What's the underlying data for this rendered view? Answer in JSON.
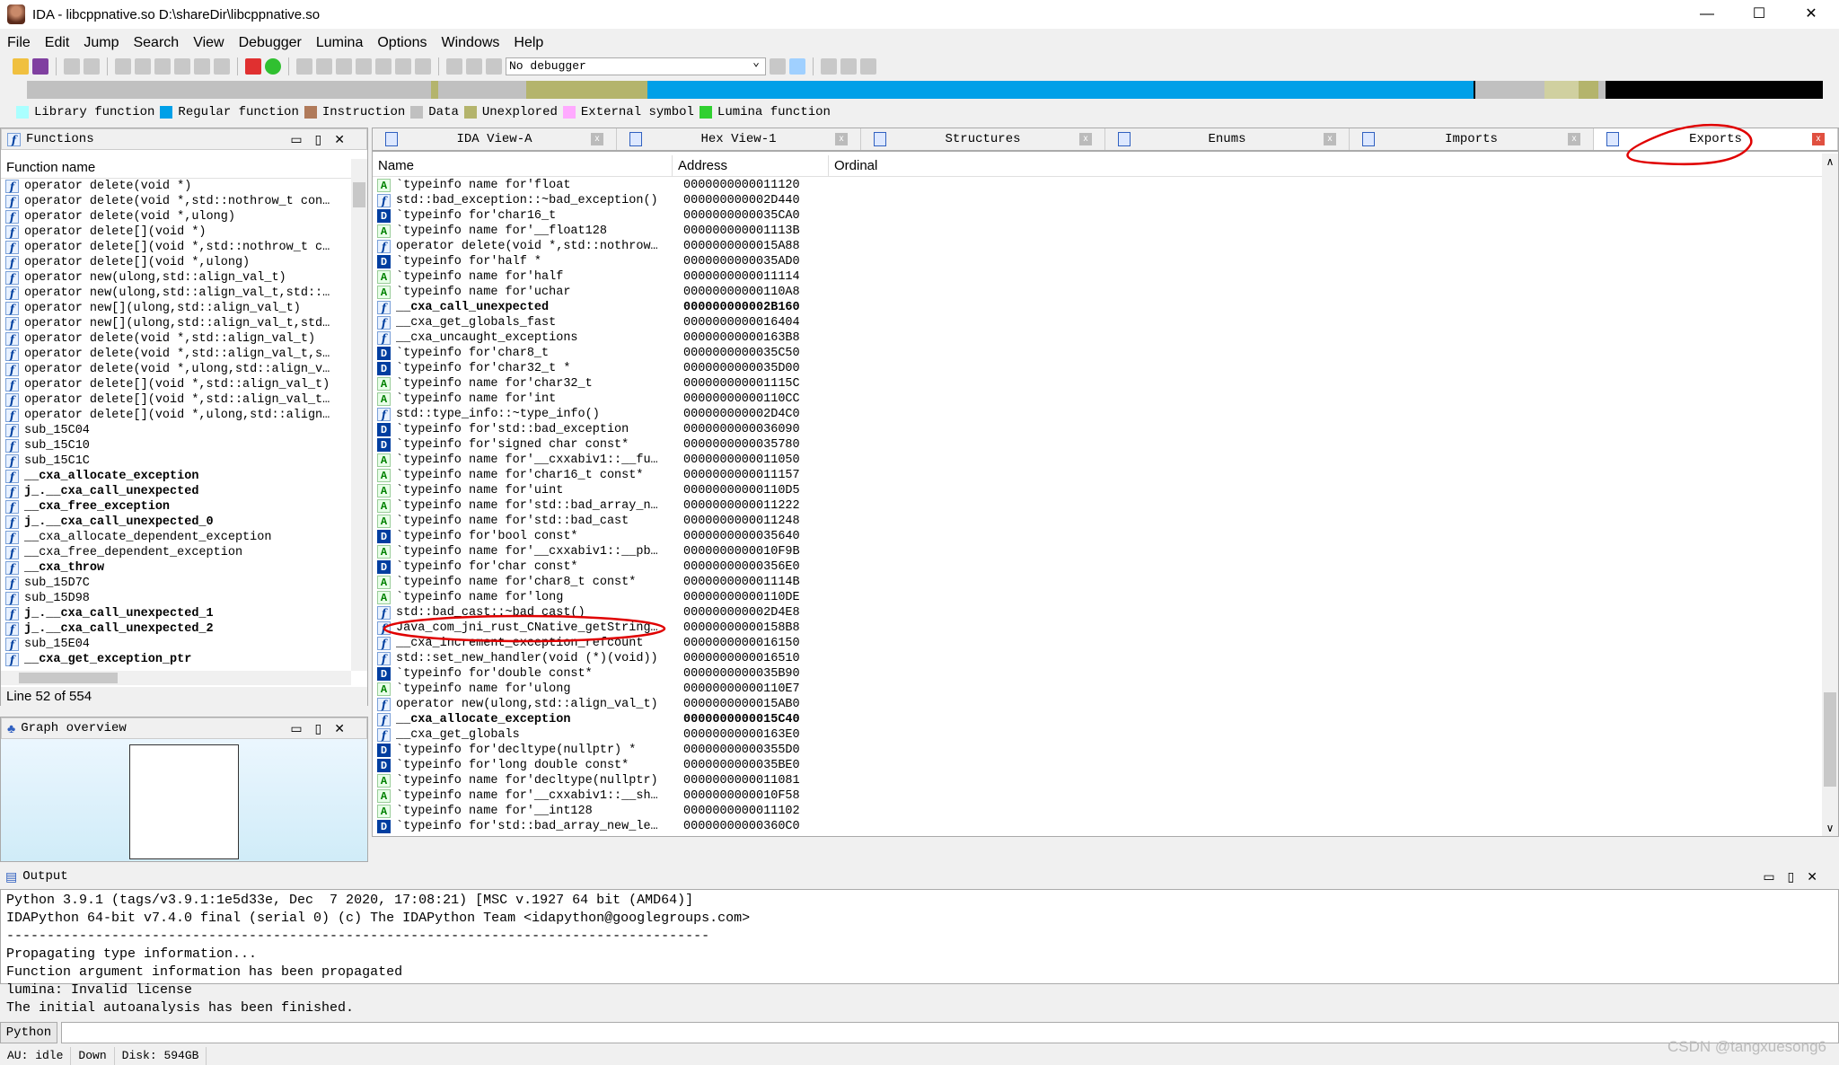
{
  "window": {
    "title": "IDA - libcppnative.so D:\\shareDir\\libcppnative.so",
    "minimize": "—",
    "maximize": "☐",
    "close": "✕"
  },
  "menu": [
    "File",
    "Edit",
    "Jump",
    "Search",
    "View",
    "Debugger",
    "Lumina",
    "Options",
    "Windows",
    "Help"
  ],
  "toolbar": {
    "debugger_select": "No debugger"
  },
  "legend": [
    {
      "label": "Library function",
      "color": "#aaffff"
    },
    {
      "label": "Regular function",
      "color": "#00a0e8"
    },
    {
      "label": "Instruction",
      "color": "#b07a5a"
    },
    {
      "label": "Data",
      "color": "#c0c0c0"
    },
    {
      "label": "Unexplored",
      "color": "#b4b46c"
    },
    {
      "label": "External symbol",
      "color": "#ffaaff"
    },
    {
      "label": "Lumina function",
      "color": "#30d030"
    }
  ],
  "functions": {
    "title": "Functions",
    "column": "Function name",
    "status": "Line 52 of 554",
    "items": [
      {
        "n": "operator delete(void *)"
      },
      {
        "n": "operator delete(void *,std::nothrow_t con…"
      },
      {
        "n": "operator delete(void *,ulong)"
      },
      {
        "n": "operator delete[](void *)"
      },
      {
        "n": "operator delete[](void *,std::nothrow_t c…"
      },
      {
        "n": "operator delete[](void *,ulong)"
      },
      {
        "n": "operator new(ulong,std::align_val_t)"
      },
      {
        "n": "operator new(ulong,std::align_val_t,std::…"
      },
      {
        "n": "operator new[](ulong,std::align_val_t)"
      },
      {
        "n": "operator new[](ulong,std::align_val_t,std…"
      },
      {
        "n": "operator delete(void *,std::align_val_t)"
      },
      {
        "n": "operator delete(void *,std::align_val_t,s…"
      },
      {
        "n": "operator delete(void *,ulong,std::align_v…"
      },
      {
        "n": "operator delete[](void *,std::align_val_t)"
      },
      {
        "n": "operator delete[](void *,std::align_val_t…"
      },
      {
        "n": "operator delete[](void *,ulong,std::align…"
      },
      {
        "n": "sub_15C04"
      },
      {
        "n": "sub_15C10"
      },
      {
        "n": "sub_15C1C"
      },
      {
        "n": "__cxa_allocate_exception",
        "b": true
      },
      {
        "n": "j_.__cxa_call_unexpected",
        "b": true
      },
      {
        "n": "__cxa_free_exception",
        "b": true
      },
      {
        "n": "j_.__cxa_call_unexpected_0",
        "b": true
      },
      {
        "n": "__cxa_allocate_dependent_exception"
      },
      {
        "n": "__cxa_free_dependent_exception"
      },
      {
        "n": "__cxa_throw",
        "b": true
      },
      {
        "n": "sub_15D7C"
      },
      {
        "n": "sub_15D98"
      },
      {
        "n": "j_.__cxa_call_unexpected_1",
        "b": true
      },
      {
        "n": "j_.__cxa_call_unexpected_2",
        "b": true
      },
      {
        "n": "sub_15E04"
      },
      {
        "n": "__cxa_get_exception_ptr",
        "b": true
      }
    ]
  },
  "graph_overview": {
    "title": "Graph overview"
  },
  "tabs": [
    {
      "label": "IDA View-A"
    },
    {
      "label": "Hex View-1"
    },
    {
      "label": "Structures"
    },
    {
      "label": "Enums"
    },
    {
      "label": "Imports"
    },
    {
      "label": "Exports",
      "active": true
    }
  ],
  "exports": {
    "columns": [
      "Name",
      "Address",
      "Ordinal"
    ],
    "rows": [
      {
        "t": "A",
        "n": "`typeinfo name for'float",
        "a": "0000000000011120"
      },
      {
        "t": "f",
        "n": "std::bad_exception::~bad_exception()",
        "a": "000000000002D440"
      },
      {
        "t": "D",
        "n": "`typeinfo for'char16_t",
        "a": "0000000000035CA0"
      },
      {
        "t": "A",
        "n": "`typeinfo name for'__float128",
        "a": "000000000001113B"
      },
      {
        "t": "f",
        "n": "operator delete(void *,std::nothrow…",
        "a": "0000000000015A88"
      },
      {
        "t": "D",
        "n": "`typeinfo for'half *",
        "a": "0000000000035AD0"
      },
      {
        "t": "A",
        "n": "`typeinfo name for'half",
        "a": "0000000000011114"
      },
      {
        "t": "A",
        "n": "`typeinfo name for'uchar",
        "a": "00000000000110A8"
      },
      {
        "t": "f",
        "n": "__cxa_call_unexpected",
        "a": "000000000002B160",
        "b": true
      },
      {
        "t": "f",
        "n": "__cxa_get_globals_fast",
        "a": "0000000000016404"
      },
      {
        "t": "f",
        "n": "__cxa_uncaught_exceptions",
        "a": "00000000000163B8"
      },
      {
        "t": "D",
        "n": "`typeinfo for'char8_t",
        "a": "0000000000035C50"
      },
      {
        "t": "D",
        "n": "`typeinfo for'char32_t *",
        "a": "0000000000035D00"
      },
      {
        "t": "A",
        "n": "`typeinfo name for'char32_t",
        "a": "000000000001115C"
      },
      {
        "t": "A",
        "n": "`typeinfo name for'int",
        "a": "00000000000110CC"
      },
      {
        "t": "f",
        "n": "std::type_info::~type_info()",
        "a": "000000000002D4C0"
      },
      {
        "t": "D",
        "n": "`typeinfo for'std::bad_exception",
        "a": "0000000000036090"
      },
      {
        "t": "D",
        "n": "`typeinfo for'signed char const*",
        "a": "0000000000035780"
      },
      {
        "t": "A",
        "n": "`typeinfo name for'__cxxabiv1::__fu…",
        "a": "0000000000011050"
      },
      {
        "t": "A",
        "n": "`typeinfo name for'char16_t const*",
        "a": "0000000000011157"
      },
      {
        "t": "A",
        "n": "`typeinfo name for'uint",
        "a": "00000000000110D5"
      },
      {
        "t": "A",
        "n": "`typeinfo name for'std::bad_array_n…",
        "a": "0000000000011222"
      },
      {
        "t": "A",
        "n": "`typeinfo name for'std::bad_cast",
        "a": "0000000000011248"
      },
      {
        "t": "D",
        "n": "`typeinfo for'bool const*",
        "a": "0000000000035640"
      },
      {
        "t": "A",
        "n": "`typeinfo name for'__cxxabiv1::__pb…",
        "a": "0000000000010F9B"
      },
      {
        "t": "D",
        "n": "`typeinfo for'char const*",
        "a": "00000000000356E0"
      },
      {
        "t": "A",
        "n": "`typeinfo name for'char8_t const*",
        "a": "000000000001114B"
      },
      {
        "t": "A",
        "n": "`typeinfo name for'long",
        "a": "00000000000110DE"
      },
      {
        "t": "f",
        "n": "std::bad_cast::~bad_cast()",
        "a": "000000000002D4E8"
      },
      {
        "t": "f",
        "n": "Java_com_jni_rust_CNative_getString…",
        "a": "00000000000158B8"
      },
      {
        "t": "f",
        "n": "__cxa_increment_exception_refcount",
        "a": "0000000000016150"
      },
      {
        "t": "f",
        "n": "std::set_new_handler(void (*)(void))",
        "a": "0000000000016510"
      },
      {
        "t": "D",
        "n": "`typeinfo for'double const*",
        "a": "0000000000035B90"
      },
      {
        "t": "A",
        "n": "`typeinfo name for'ulong",
        "a": "00000000000110E7"
      },
      {
        "t": "f",
        "n": "operator new(ulong,std::align_val_t)",
        "a": "0000000000015AB0"
      },
      {
        "t": "f",
        "n": "__cxa_allocate_exception",
        "a": "0000000000015C40",
        "b": true
      },
      {
        "t": "f",
        "n": "__cxa_get_globals",
        "a": "00000000000163E0"
      },
      {
        "t": "D",
        "n": "`typeinfo for'decltype(nullptr) *",
        "a": "00000000000355D0"
      },
      {
        "t": "D",
        "n": "`typeinfo for'long double const*",
        "a": "0000000000035BE0"
      },
      {
        "t": "A",
        "n": "`typeinfo name for'decltype(nullptr)",
        "a": "0000000000011081"
      },
      {
        "t": "A",
        "n": "`typeinfo name for'__cxxabiv1::__sh…",
        "a": "0000000000010F58"
      },
      {
        "t": "A",
        "n": "`typeinfo name for'__int128",
        "a": "0000000000011102"
      },
      {
        "t": "D",
        "n": "`typeinfo for'std::bad_array_new_le…",
        "a": "00000000000360C0"
      }
    ]
  },
  "output": {
    "title": "Output",
    "lines": [
      "Python 3.9.1 (tags/v3.9.1:1e5d33e, Dec  7 2020, 17:08:21) [MSC v.1927 64 bit (AMD64)]",
      "IDAPython 64-bit v7.4.0 final (serial 0) (c) The IDAPython Team <idapython@googlegroups.com>",
      "---------------------------------------------------------------------------------------",
      "Propagating type information...",
      "Function argument information has been propagated",
      "lumina: Invalid license",
      "The initial autoanalysis has been finished."
    ],
    "python_button": "Python"
  },
  "status": {
    "au": "AU:  idle",
    "dir": "Down",
    "disk": "Disk: 594GB"
  },
  "watermark": "CSDN @tangxuesong6",
  "annotation_color": "#e00000"
}
